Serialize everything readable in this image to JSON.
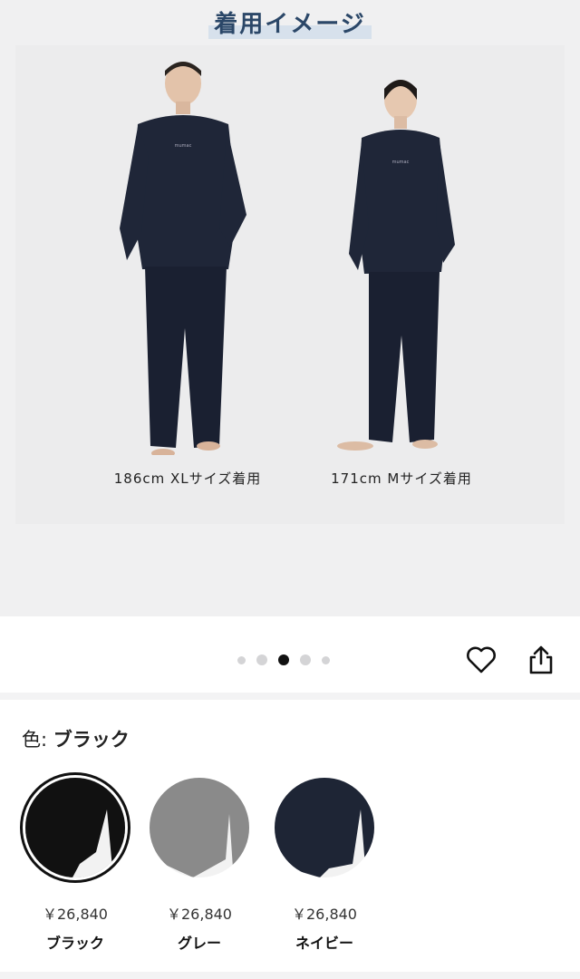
{
  "hero": {
    "title": "着用イメージ",
    "models": [
      {
        "caption": "186cm XLサイズ着用"
      },
      {
        "caption": "171cm Mサイズ着用"
      }
    ]
  },
  "carousel": {
    "total": 5,
    "active_index": 2
  },
  "actions": {
    "favorite_icon": "heart-icon",
    "share_icon": "share-icon"
  },
  "color_selector": {
    "label": "色:",
    "selected_value": "ブラック",
    "options": [
      {
        "name": "ブラック",
        "price": "￥26,840",
        "color": "#111111"
      },
      {
        "name": "グレー",
        "price": "￥26,840",
        "color": "#8a8a8a"
      },
      {
        "name": "ネイビー",
        "price": "￥26,840",
        "color": "#1e2535"
      }
    ]
  }
}
